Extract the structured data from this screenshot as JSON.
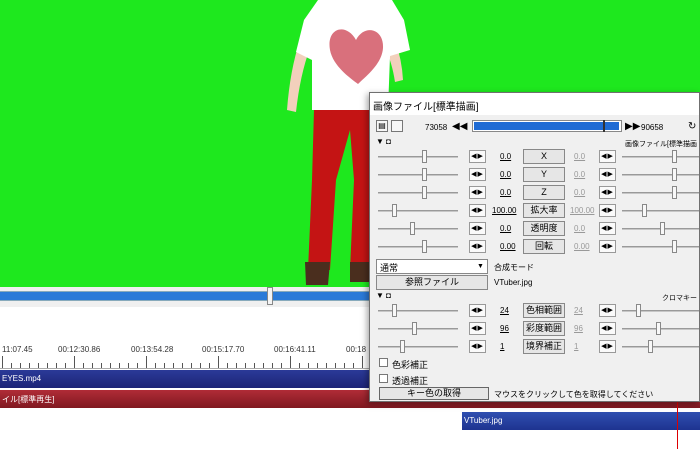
{
  "dialog": {
    "title": "画像ファイル[標準描画]",
    "frame_start": "73058",
    "frame_end": "90658",
    "frame_position": 0.97,
    "section1_tail": "画像ファイル[標準描画",
    "params": [
      {
        "value": "0.0",
        "label": "X",
        "right_value": "0.0"
      },
      {
        "value": "0.0",
        "label": "Y",
        "right_value": "0.0"
      },
      {
        "value": "0.0",
        "label": "Z",
        "right_value": "0.0"
      },
      {
        "value": "100.00",
        "label": "拡大率",
        "right_value": "100.00"
      },
      {
        "value": "0.0",
        "label": "透明度",
        "right_value": "0.0"
      },
      {
        "value": "0.00",
        "label": "回転",
        "right_value": "0.00"
      }
    ],
    "blend_mode": "通常",
    "blend_label": "合成モード",
    "ref_button": "参照ファイル",
    "ref_file": "VTuber.jpg",
    "section2_tail": "クロマキー",
    "chroma": [
      {
        "value": "24",
        "label": "色相範囲",
        "right_value": "24"
      },
      {
        "value": "96",
        "label": "彩度範囲",
        "right_value": "96"
      },
      {
        "value": "1",
        "label": "境界補正",
        "right_value": "1"
      }
    ],
    "check1": "色彩補正",
    "check2": "透過補正",
    "keycolor_button": "キー色の取得",
    "hint": "マウスをクリックして色を取得してください"
  },
  "timeline": {
    "ticks": [
      "11:07.45",
      "00:12:30.86",
      "00:13:54.28",
      "00:15:17.70",
      "00:16:41.11",
      "00:18"
    ],
    "clip_video": "EYES.mp4",
    "clip_audio": "イル[標準再生]",
    "clip_image": "VTuber.jpg"
  },
  "colors": {
    "greenscreen": "#1ee81e",
    "shirt": "#ffffff",
    "pants": "#c41414",
    "heart": "#d9707c"
  }
}
